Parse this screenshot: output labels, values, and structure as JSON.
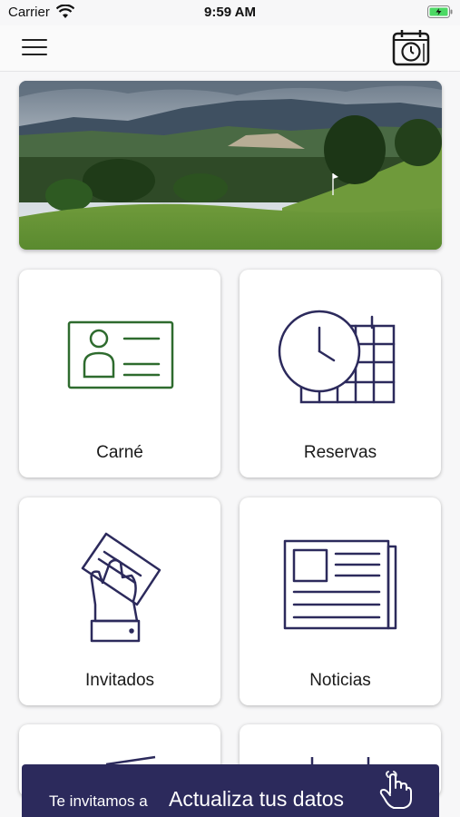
{
  "status_bar": {
    "carrier": "Carrier",
    "time": "9:59 AM"
  },
  "navbar": {
    "menu_icon": "hamburger-icon",
    "calendar_icon": "calendar-clock-icon"
  },
  "banner": {
    "image": "golf-course-landscape"
  },
  "tiles": [
    {
      "label": "Carné",
      "icon": "id-card-icon",
      "color": "#2e6b2e"
    },
    {
      "label": "Reservas",
      "icon": "clock-calendar-icon",
      "color": "#2c2a5c"
    },
    {
      "label": "Invitados",
      "icon": "hand-holding-ticket-icon",
      "color": "#2c2a5c"
    },
    {
      "label": "Noticias",
      "icon": "newspaper-icon",
      "color": "#2c2a5c"
    }
  ],
  "update_banner": {
    "prefix": "Te invitamos a",
    "action": "Actualiza tus datos",
    "icon": "tap-hand-icon",
    "background": "#2c2a5c"
  }
}
